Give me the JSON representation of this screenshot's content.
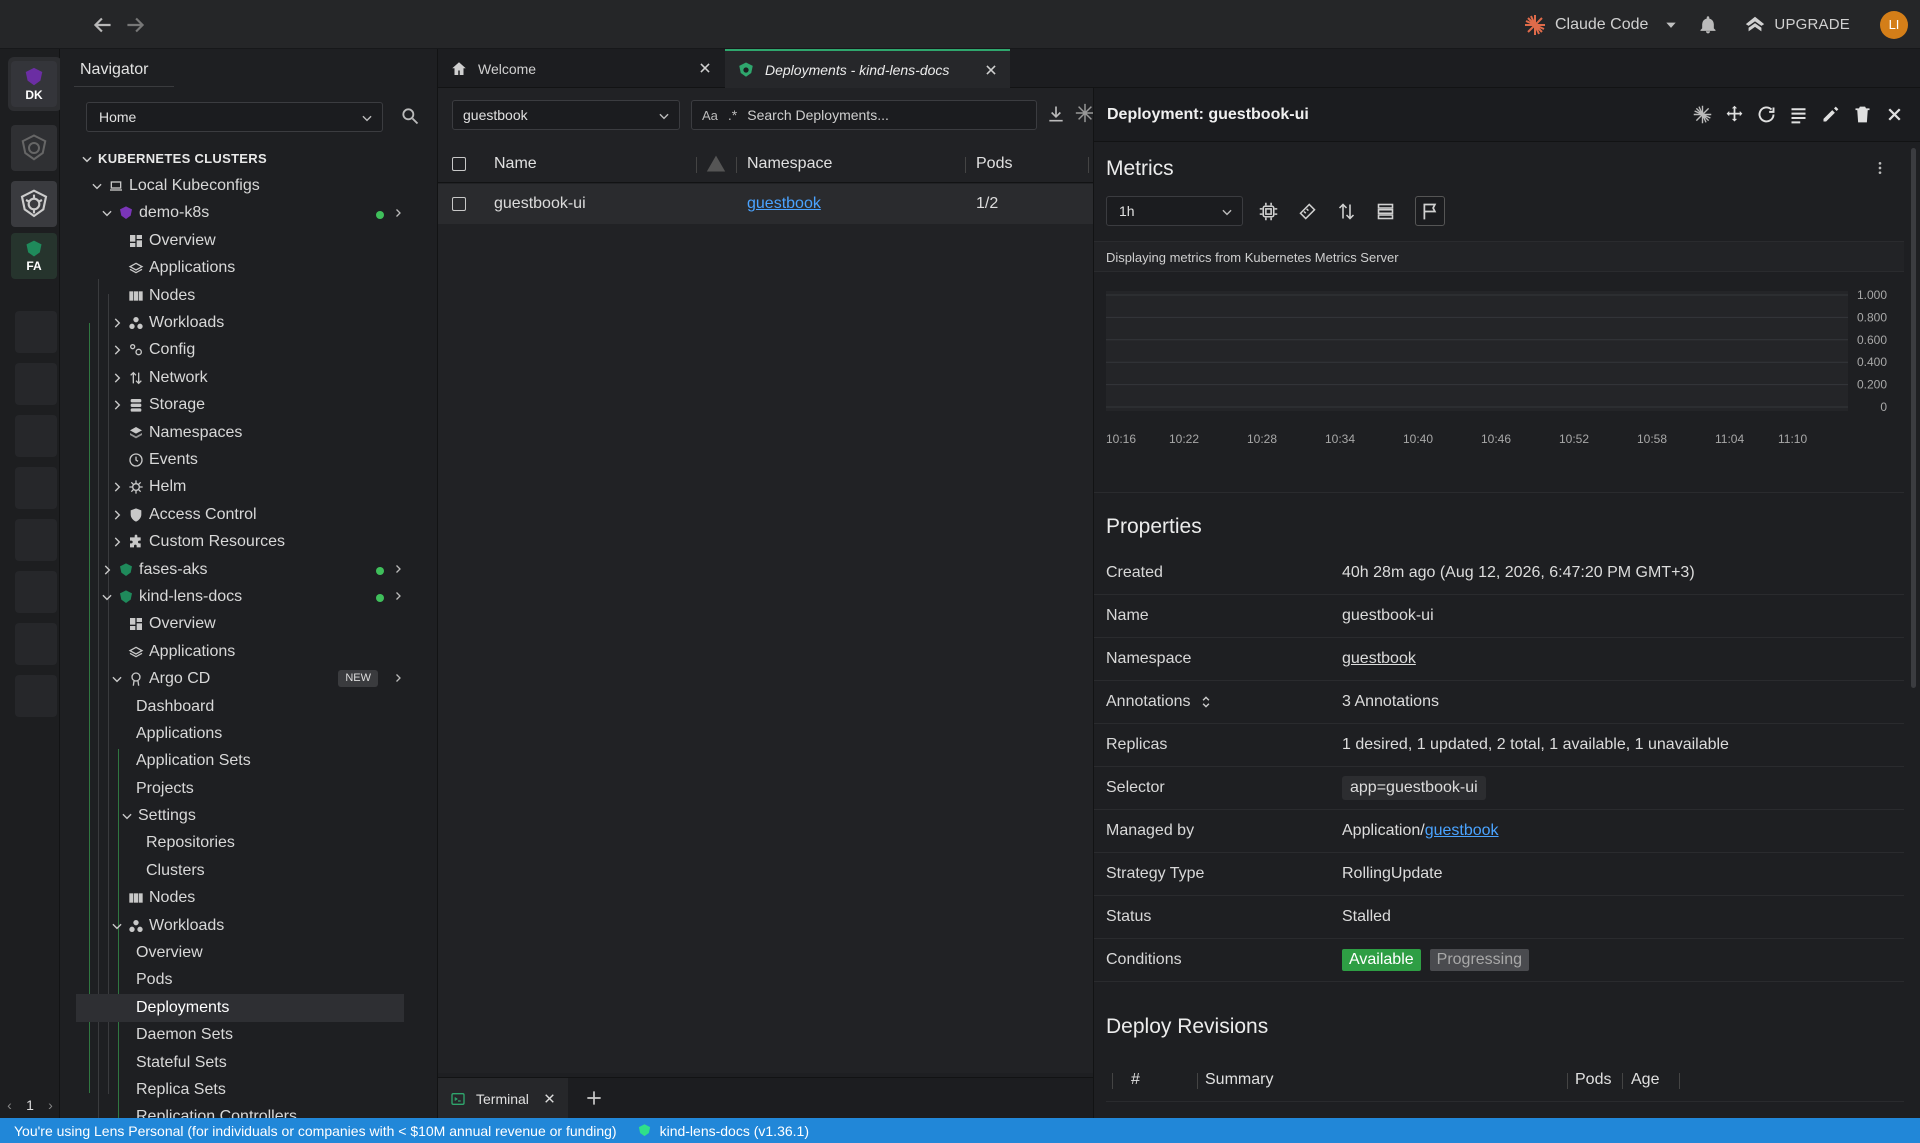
{
  "topbar": {
    "claude_label": "Claude Code",
    "upgrade_label": "UPGRADE",
    "avatar_initials": "LI",
    "accent_claude": "#e06b4a"
  },
  "hotbar": {
    "items": [
      {
        "label": "DK",
        "color": "#6b2ea3"
      },
      {
        "label": "",
        "color": "#555"
      },
      {
        "label": "",
        "color": "#555"
      },
      {
        "label": "FA",
        "color": "#1f8a5b"
      }
    ],
    "page_number": "1"
  },
  "navigator": {
    "tab_label": "Navigator",
    "select_value": "Home",
    "section_title": "KUBERNETES CLUSTERS",
    "local_label": "Local Kubeconfigs",
    "demo": {
      "name": "demo-k8s",
      "items": [
        "Overview",
        "Applications",
        "Nodes",
        "Workloads",
        "Config",
        "Network",
        "Storage",
        "Namespaces",
        "Events",
        "Helm",
        "Access Control",
        "Custom Resources"
      ]
    },
    "fases": "fases-aks",
    "kind": {
      "name": "kind-lens-docs",
      "overview": "Overview",
      "applications": "Applications",
      "argo": "Argo CD",
      "argo_badge": "NEW",
      "argo_items": [
        "Dashboard",
        "Applications",
        "Application Sets",
        "Projects"
      ],
      "settings": "Settings",
      "settings_items": [
        "Repositories",
        "Clusters"
      ],
      "nodes": "Nodes",
      "workloads": "Workloads",
      "workload_items": [
        "Overview",
        "Pods",
        "Deployments",
        "Daemon Sets",
        "Stateful Sets",
        "Replica Sets",
        "Replication Controllers"
      ]
    }
  },
  "tabs": {
    "welcome": "Welcome",
    "deployments": "Deployments - kind-lens-docs"
  },
  "list": {
    "namespace_value": "guestbook",
    "search_case_label": "Aa",
    "search_placeholder": "Search Deployments...",
    "headers": {
      "name": "Name",
      "namespace": "Namespace",
      "pods": "Pods"
    },
    "rows": [
      {
        "name": "guestbook-ui",
        "namespace": "guestbook",
        "pods": "1/2"
      }
    ]
  },
  "terminal": {
    "label": "Terminal"
  },
  "details": {
    "title": "Deployment: guestbook-ui",
    "metrics_title": "Metrics",
    "range_value": "1h",
    "metrics_note": "Displaying metrics from Kubernetes Metrics Server",
    "properties_title": "Properties",
    "properties": {
      "created_k": "Created",
      "created_v": "40h 28m ago (Aug 12, 2026, 6:47:20 PM GMT+3)",
      "name_k": "Name",
      "name_v": "guestbook-ui",
      "namespace_k": "Namespace",
      "namespace_v": "guestbook",
      "annotations_k": "Annotations",
      "annotations_v": "3 Annotations",
      "replicas_k": "Replicas",
      "replicas_v": "1 desired, 1 updated, 2 total, 1 available, 1 unavailable",
      "selector_k": "Selector",
      "selector_v": "app=guestbook-ui",
      "managed_k": "Managed by",
      "managed_prefix": "Application/",
      "managed_link": "guestbook",
      "strategy_k": "Strategy Type",
      "strategy_v": "RollingUpdate",
      "status_k": "Status",
      "status_v": "Stalled",
      "conditions_k": "Conditions",
      "cond_available": "Available",
      "cond_progressing": "Progressing"
    },
    "revisions_title": "Deploy Revisions",
    "revisions_headers": {
      "num": "#",
      "summary": "Summary",
      "pods": "Pods",
      "age": "Age"
    }
  },
  "chart_data": {
    "type": "line",
    "x": [
      "10:16",
      "10:22",
      "10:28",
      "10:34",
      "10:40",
      "10:46",
      "10:52",
      "10:58",
      "11:04",
      "11:10"
    ],
    "yticks": [
      "1.000",
      "0.800",
      "0.600",
      "0.400",
      "0.200",
      "0"
    ],
    "ylim": [
      0,
      1
    ],
    "series": [],
    "grid": true
  },
  "statusbar": {
    "license_text": "You're using Lens Personal (for individuals or companies with < $10M annual revenue or funding)",
    "context": "kind-lens-docs (v1.36.1)"
  }
}
